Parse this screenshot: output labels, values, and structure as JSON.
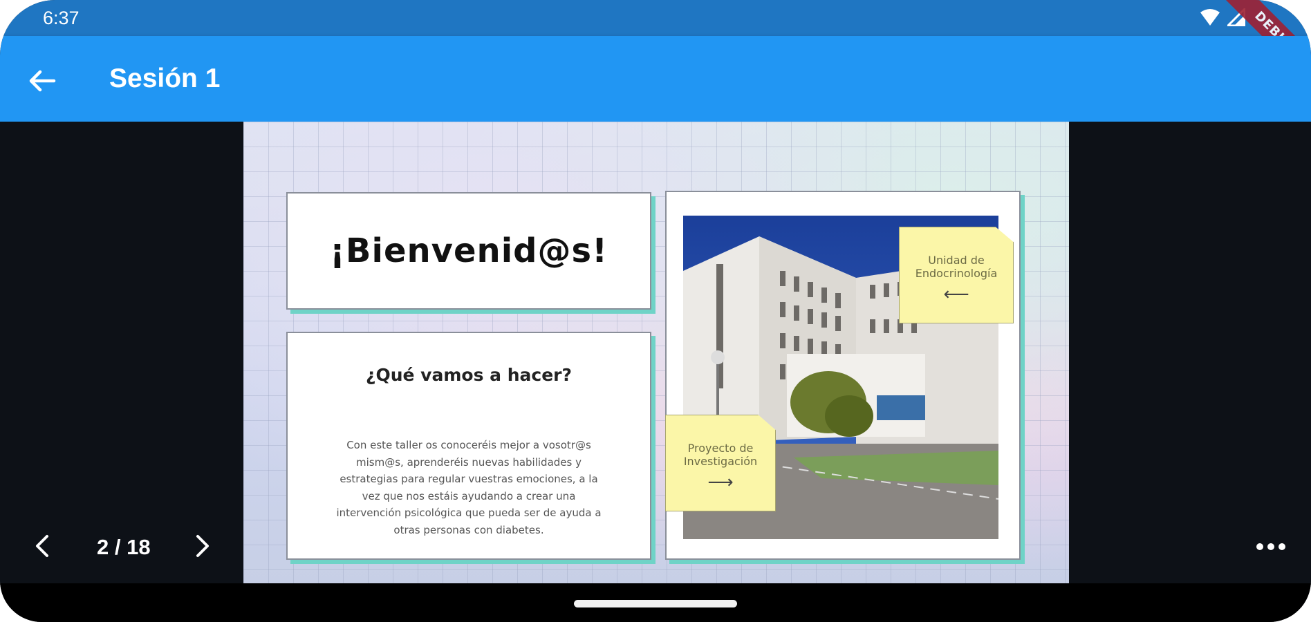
{
  "status_bar": {
    "time": "6:37",
    "icons": [
      "wifi-icon",
      "signal-icon"
    ],
    "debug_banner": "DEBUG"
  },
  "app_bar": {
    "title": "Sesión 1",
    "back_icon": "arrow-left-icon"
  },
  "slide": {
    "welcome_title": "¡Bienvenid@s!",
    "section_heading": "¿Qué vamos a hacer?",
    "section_body": "Con este taller os conoceréis mejor a vosotr@s mism@s, aprenderéis nuevas habilidades y estrategias para regular vuestras emociones, a la vez que nos estáis ayudando a crear una intervención psicológica que pueda ser de ayuda a otras personas con diabetes.",
    "note_1": {
      "text": "Unidad de Endocrinología",
      "arrow": "⟵"
    },
    "note_2": {
      "text": "Proyecto de Investigación",
      "arrow": "⟶"
    }
  },
  "viewer_controls": {
    "page_indicator": "2 / 18",
    "prev_icon": "chevron-left-icon",
    "next_icon": "chevron-right-icon",
    "more_icon": "more-horizontal-icon"
  },
  "colors": {
    "status_bar": "#1f76c2",
    "app_bar": "#2196f3",
    "viewer_background": "#0d1117",
    "card_shadow": "#6fd3c7",
    "sticky_note": "#fbf6a8"
  }
}
